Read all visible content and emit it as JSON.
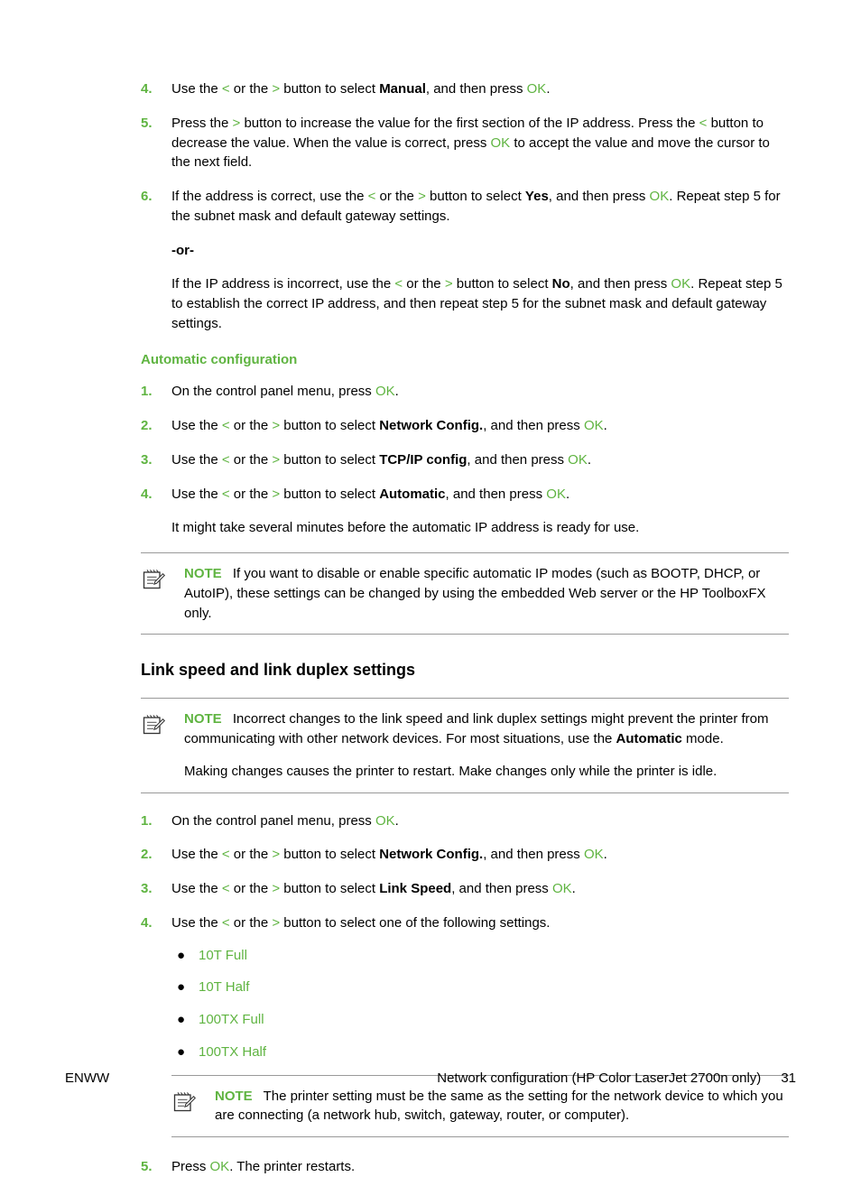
{
  "steps_top": [
    {
      "num": "4.",
      "prefix": "Use the ",
      "lt": "<",
      "mid1": " or the ",
      "gt": ">",
      "mid2": " button to select ",
      "bold": "Manual",
      "after_bold": ", and then press ",
      "ok": "OK",
      "tail": "."
    },
    {
      "num": "5.",
      "raw": true
    }
  ],
  "step5": {
    "text1a": "Press the ",
    "gt": ">",
    "text1b": " button to increase the value for the first section of the IP address. Press the ",
    "lt": "<",
    "text1c": " button to decrease the value. When the value is correct, press ",
    "ok": "OK",
    "text1d": " to accept the value and move the cursor to the next field."
  },
  "step6": {
    "num": "6.",
    "p1a": "If the address is correct, use the ",
    "lt": "<",
    "p1b": " or the ",
    "gt": ">",
    "p1c": " button to select ",
    "bold1": "Yes",
    "p1d": ", and then press ",
    "ok": "OK",
    "p1e": ". Repeat step 5 for the subnet mask and default gateway settings.",
    "or": "-or-",
    "p2a": "If the IP address is incorrect, use the ",
    "p2b": " or the ",
    "p2c": " button to select ",
    "bold2": "No",
    "p2d": ", and then press ",
    "p2e": ". Repeat step 5 to establish the correct IP address, and then repeat step 5 for the subnet mask and default gateway settings."
  },
  "auto_head": "Automatic configuration",
  "auto_steps": [
    {
      "num": "1.",
      "text_a": "On the control panel menu, press ",
      "ok": "OK",
      "tail": "."
    },
    {
      "num": "2.",
      "use": true,
      "bold": "Network Config.",
      "after": ", and then press ",
      "ok": "OK",
      "tail": "."
    },
    {
      "num": "3.",
      "use": true,
      "bold": "TCP/IP config",
      "after": ", and then press ",
      "ok": "OK",
      "tail": "."
    },
    {
      "num": "4.",
      "use": true,
      "bold": "Automatic",
      "after": ", and then press ",
      "ok": "OK",
      "tail": ".",
      "extra": "It might take several minutes before the automatic IP address is ready for use."
    }
  ],
  "use_phrase": {
    "a": "Use the ",
    "lt": "<",
    "b": " or the ",
    "gt": ">",
    "c": " button to select "
  },
  "note1": {
    "label": "NOTE",
    "text": " If you want to disable or enable specific automatic IP modes (such as BOOTP, DHCP, or AutoIP), these settings can be changed by using the embedded Web server or the HP ToolboxFX only."
  },
  "link_head": "Link speed and link duplex settings",
  "note2": {
    "label": "NOTE",
    "p1a": " Incorrect changes to the link speed and link duplex settings might prevent the printer from communicating with other network devices. For most situations, use the ",
    "bold": "Automatic",
    "p1b": " mode.",
    "p2": "Making changes causes the printer to restart. Make changes only while the printer is idle."
  },
  "link_steps": [
    {
      "num": "1.",
      "text_a": "On the control panel menu, press ",
      "ok": "OK",
      "tail": "."
    },
    {
      "num": "2.",
      "use": true,
      "bold": "Network Config.",
      "after": ", and then press ",
      "ok": "OK",
      "tail": "."
    },
    {
      "num": "3.",
      "use": true,
      "bold": "Link Speed",
      "after": ", and then press ",
      "ok": "OK",
      "tail": "."
    },
    {
      "num": "4.",
      "use_simple": true,
      "after_simple": " button to select one of the following settings."
    }
  ],
  "bullets": [
    "10T Full",
    "10T Half",
    "100TX Full",
    "100TX Half"
  ],
  "note3": {
    "label": "NOTE",
    "text": " The printer setting must be the same as the setting for the network device to which you are connecting (a network hub, switch, gateway, router, or computer)."
  },
  "step_last": {
    "num": "5.",
    "a": "Press ",
    "ok": "OK",
    "b": ". The printer restarts."
  },
  "footer": {
    "left": "ENWW",
    "right": "Network configuration (HP Color LaserJet 2700n only)",
    "page": "31"
  }
}
